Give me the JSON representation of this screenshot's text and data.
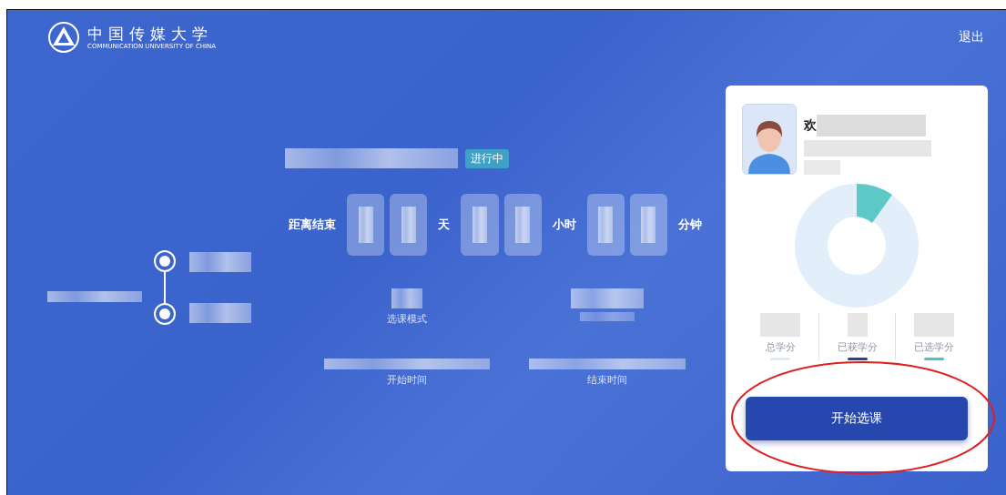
{
  "header": {
    "logo_text": "中国传媒大学",
    "logo_subtitle": "COMMUNICATION UNIVERSITY OF CHINA",
    "logout": "退出"
  },
  "round": {
    "status": "进行中"
  },
  "countdown": {
    "label": "距离结束",
    "units": [
      "天",
      "小时",
      "分钟"
    ]
  },
  "info": [
    {
      "label": "选课模式"
    },
    {
      "label": "开始时间"
    },
    {
      "label": "结束时间"
    }
  ],
  "card": {
    "welcome": "欢",
    "credits": [
      {
        "label": "总学分",
        "color": "#dde9fb"
      },
      {
        "label": "已获学分",
        "color": "#2c3e91"
      },
      {
        "label": "已选学分",
        "color": "#4fc3c4"
      }
    ],
    "button": "开始选课"
  }
}
